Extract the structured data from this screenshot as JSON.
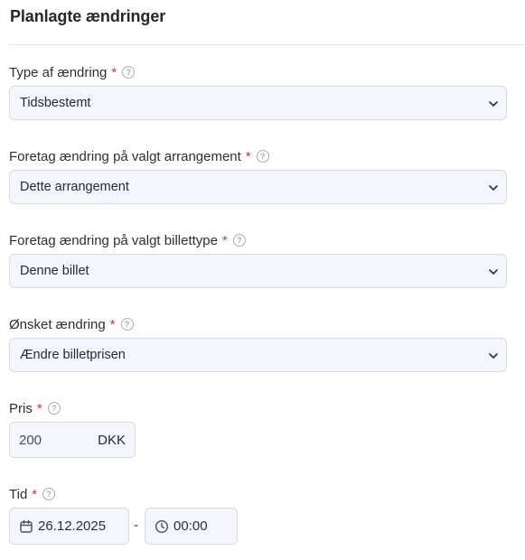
{
  "panel": {
    "title": "Planlagte ændringer"
  },
  "fields": {
    "change_type": {
      "label": "Type af ændring",
      "required_mark": "*",
      "value": "Tidsbestemt"
    },
    "event_scope": {
      "label": "Foretag ændring på valgt arrangement",
      "required_mark": "*",
      "value": "Dette arrangement"
    },
    "ticket_scope": {
      "label": "Foretag ændring på valgt billettype",
      "required_mark": "*",
      "value": "Denne billet"
    },
    "desired_change": {
      "label": "Ønsket ændring",
      "required_mark": "*",
      "value": "Ændre billetprisen"
    },
    "price": {
      "label": "Pris",
      "required_mark": "*",
      "value": "200",
      "currency": "DKK"
    },
    "time": {
      "label": "Tid",
      "required_mark": "*",
      "date": "26.12.2025",
      "separator": "-",
      "clock": "00:00"
    }
  },
  "help_glyph": "?",
  "icons": {
    "help": "question-circle-icon",
    "chevron": "chevron-down-icon",
    "date": "calendar-icon",
    "clock": "clock-icon"
  },
  "colors": {
    "required": "#b4422b",
    "field_bg": "#f4f6fb",
    "field_border": "#d6dae0"
  }
}
